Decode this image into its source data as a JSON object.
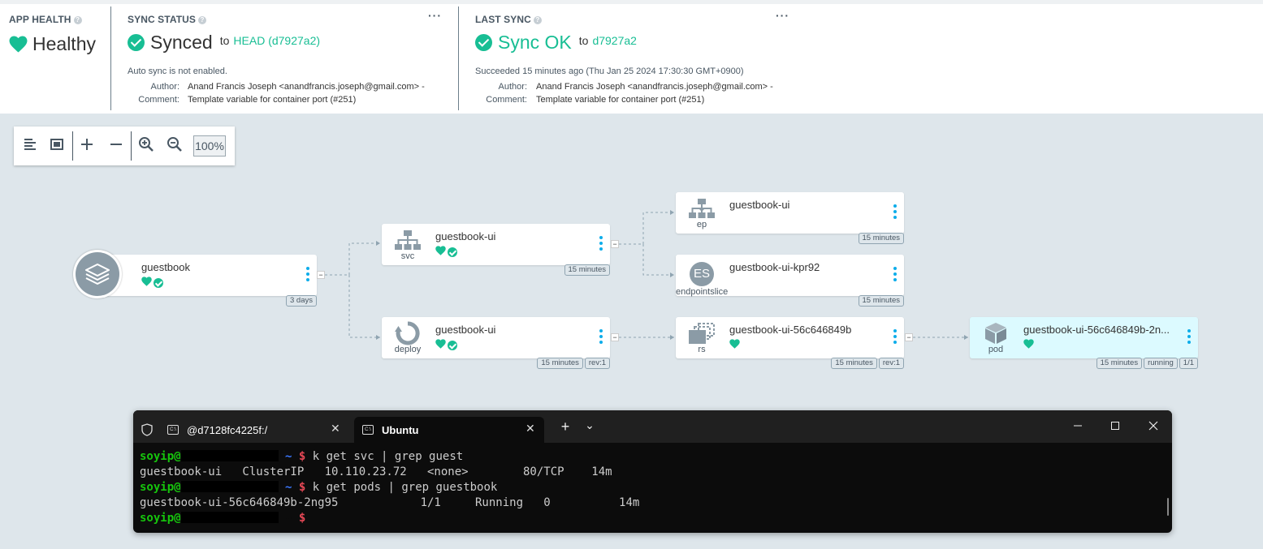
{
  "app_health": {
    "title": "APP HEALTH",
    "status": "Healthy"
  },
  "sync_status": {
    "title": "SYNC STATUS",
    "status": "Synced",
    "to_label": "to",
    "target": "HEAD (d7927a2)",
    "auto_sync": "Auto sync is not enabled.",
    "author_label": "Author:",
    "author": "Anand Francis Joseph <anandfrancis.joseph@gmail.com> -",
    "comment_label": "Comment:",
    "comment": "Template variable for container port (#251)"
  },
  "last_sync": {
    "title": "LAST SYNC",
    "status": "Sync OK",
    "to_label": "to",
    "revision": "d7927a2",
    "succeeded": "Succeeded 15 minutes ago (Thu Jan 25 2024 17:30:30 GMT+0900)",
    "author_label": "Author:",
    "author": "Anand Francis Joseph <anandfrancis.joseph@gmail.com> -",
    "comment_label": "Comment:",
    "comment": "Template variable for container port (#251)"
  },
  "toolbar": {
    "zoom": "100%"
  },
  "nodes": {
    "app": {
      "name": "guestbook",
      "age": "3 days"
    },
    "svc": {
      "kind": "svc",
      "name": "guestbook-ui",
      "age": "15 minutes"
    },
    "deploy": {
      "kind": "deploy",
      "name": "guestbook-ui",
      "age": "15 minutes",
      "rev": "rev:1"
    },
    "ep": {
      "kind": "ep",
      "name": "guestbook-ui",
      "age": "15 minutes"
    },
    "endpointslice": {
      "kind": "endpointslice",
      "icon_text": "ES",
      "name": "guestbook-ui-kpr92",
      "age": "15 minutes"
    },
    "rs": {
      "kind": "rs",
      "name": "guestbook-ui-56c646849b",
      "age": "15 minutes",
      "rev": "rev:1"
    },
    "pod": {
      "kind": "pod",
      "name": "guestbook-ui-56c646849b-2ng95",
      "name_display": "guestbook-ui-56c646849b-2n...",
      "age": "15 minutes",
      "state": "running",
      "ready": "1/1"
    }
  },
  "terminal": {
    "tabs": [
      {
        "label": "@d7128fc4225f:/"
      },
      {
        "label": "Ubuntu"
      }
    ],
    "new_tab": "+",
    "dropdown": "⌄",
    "prompt_user": "soyip@",
    "prompt_tilde": "~",
    "prompt_dollar": "$",
    "lines": [
      {
        "cmd": "k get svc | grep guest"
      },
      {
        "out": "guestbook-ui   ClusterIP   10.110.23.72   <none>        80/TCP    14m"
      },
      {
        "cmd": "k get pods | grep guestbook"
      },
      {
        "out": "guestbook-ui-56c646849b-2ng95            1/1     Running   0          14m"
      },
      {
        "cmd": ""
      }
    ]
  },
  "colors": {
    "accent": "#18be94",
    "link": "#0dadea",
    "graph_bg": "#dee6eb",
    "terminal_bg": "#0c0c0c",
    "prompt_green": "#16c60c",
    "prompt_blue": "#3b78ff",
    "prompt_red": "#e74856"
  }
}
